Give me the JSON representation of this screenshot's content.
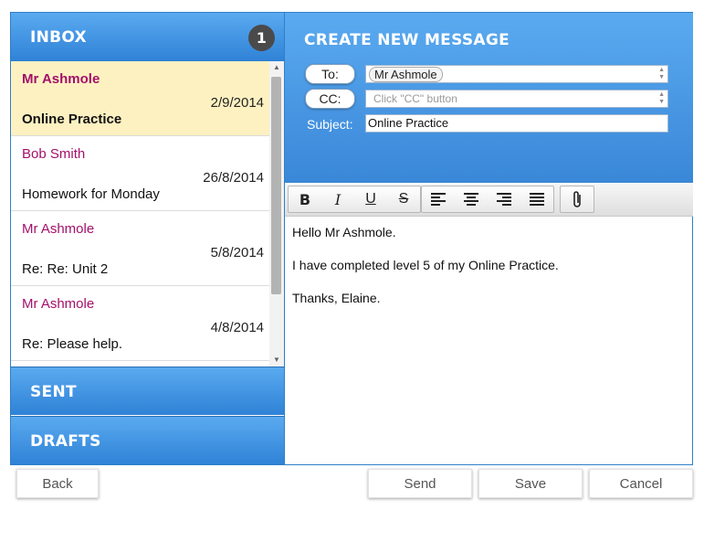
{
  "inbox": {
    "title": "INBOX",
    "unread_count": "1",
    "messages": [
      {
        "sender": "Mr Ashmole",
        "date": "2/9/2014",
        "subject": "Online Practice"
      },
      {
        "sender": "Bob Smith",
        "date": "26/8/2014",
        "subject": "Homework for Monday"
      },
      {
        "sender": "Mr Ashmole",
        "date": "5/8/2014",
        "subject": "Re: Re: Unit 2"
      },
      {
        "sender": "Mr Ashmole",
        "date": "4/8/2014",
        "subject": "Re: Please help."
      }
    ]
  },
  "sent": {
    "title": "SENT"
  },
  "drafts": {
    "title": "DRAFTS"
  },
  "compose": {
    "title": "CREATE NEW MESSAGE",
    "to_label": "To:",
    "to_value": "Mr Ashmole",
    "cc_label": "CC:",
    "cc_placeholder": "Click \"CC\" button",
    "subject_label": "Subject:",
    "subject_value": "Online Practice",
    "body": [
      "Hello Mr Ashmole.",
      "I have completed level 5 of my Online Practice.",
      "Thanks, Elaine."
    ]
  },
  "toolbar": {
    "bold": "B",
    "italic": "I",
    "underline": "U",
    "strike": "S"
  },
  "buttons": {
    "back": "Back",
    "send": "Send",
    "save": "Save",
    "cancel": "Cancel"
  },
  "colors": {
    "accent": "#3a87d8",
    "sender": "#a3106a",
    "selected_bg": "#fdf1c1"
  }
}
